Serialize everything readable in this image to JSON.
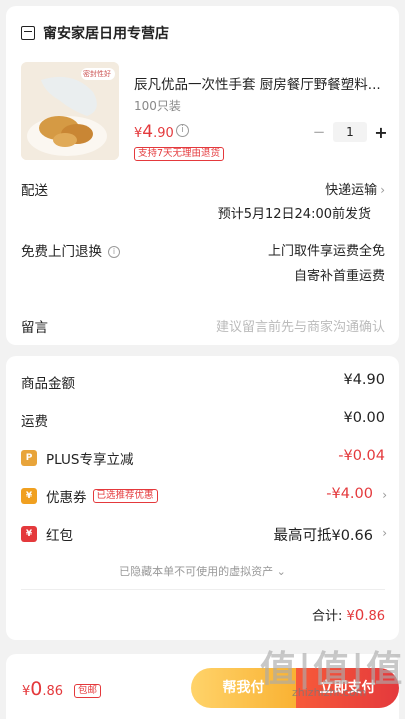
{
  "shop": {
    "name": "甯安家居日用专营店",
    "icon": "shop-icon"
  },
  "product": {
    "title": "辰凡优品一次性手套 厨房餐厅野餐塑料...",
    "spec": "100只装",
    "price_symbol": "¥",
    "price_main": "4",
    "price_decimal": ".90",
    "quantity": "1",
    "minus": "−",
    "plus": "+",
    "return_badge": "支持7天无理由退货",
    "image_badge": "密封性好"
  },
  "delivery": {
    "label": "配送",
    "method": "快递运输",
    "estimate": "预计5月12日24:00前发货"
  },
  "return_service": {
    "label": "免费上门退换",
    "line1": "上门取件享运费全免",
    "line2": "自寄补首重运费"
  },
  "message": {
    "label": "留言",
    "placeholder": "建议留言前先与商家沟通确认"
  },
  "costs": {
    "goods_label": "商品金额",
    "goods_value": "¥4.90",
    "shipping_label": "运费",
    "shipping_value": "¥0.00",
    "plus_label": "PLUS专享立减",
    "plus_value": "-¥0.04",
    "coupon_label": "优惠券",
    "coupon_badge": "已选推荐优惠",
    "coupon_value": "-¥4.00",
    "redpack_label": "红包",
    "redpack_value": "最高可抵¥0.66",
    "hidden_assets": "已隐藏本单不可使用的虚拟资产",
    "total_label": "合计:",
    "total_symbol": "¥",
    "total_main": "0",
    "total_decimal": ".86"
  },
  "bottom_bar": {
    "price_symbol": "¥",
    "price_main": "0",
    "price_decimal": ".86",
    "free_shipping": "包邮",
    "help_pay": "帮我付",
    "pay_now": "立即支付"
  },
  "watermark": {
    "text": "值|值|值",
    "sub": "zhizhizhi.com"
  },
  "colors": {
    "accent": "#e4393c",
    "help_pay": "#f9b233",
    "background": "#f2f2f2"
  }
}
